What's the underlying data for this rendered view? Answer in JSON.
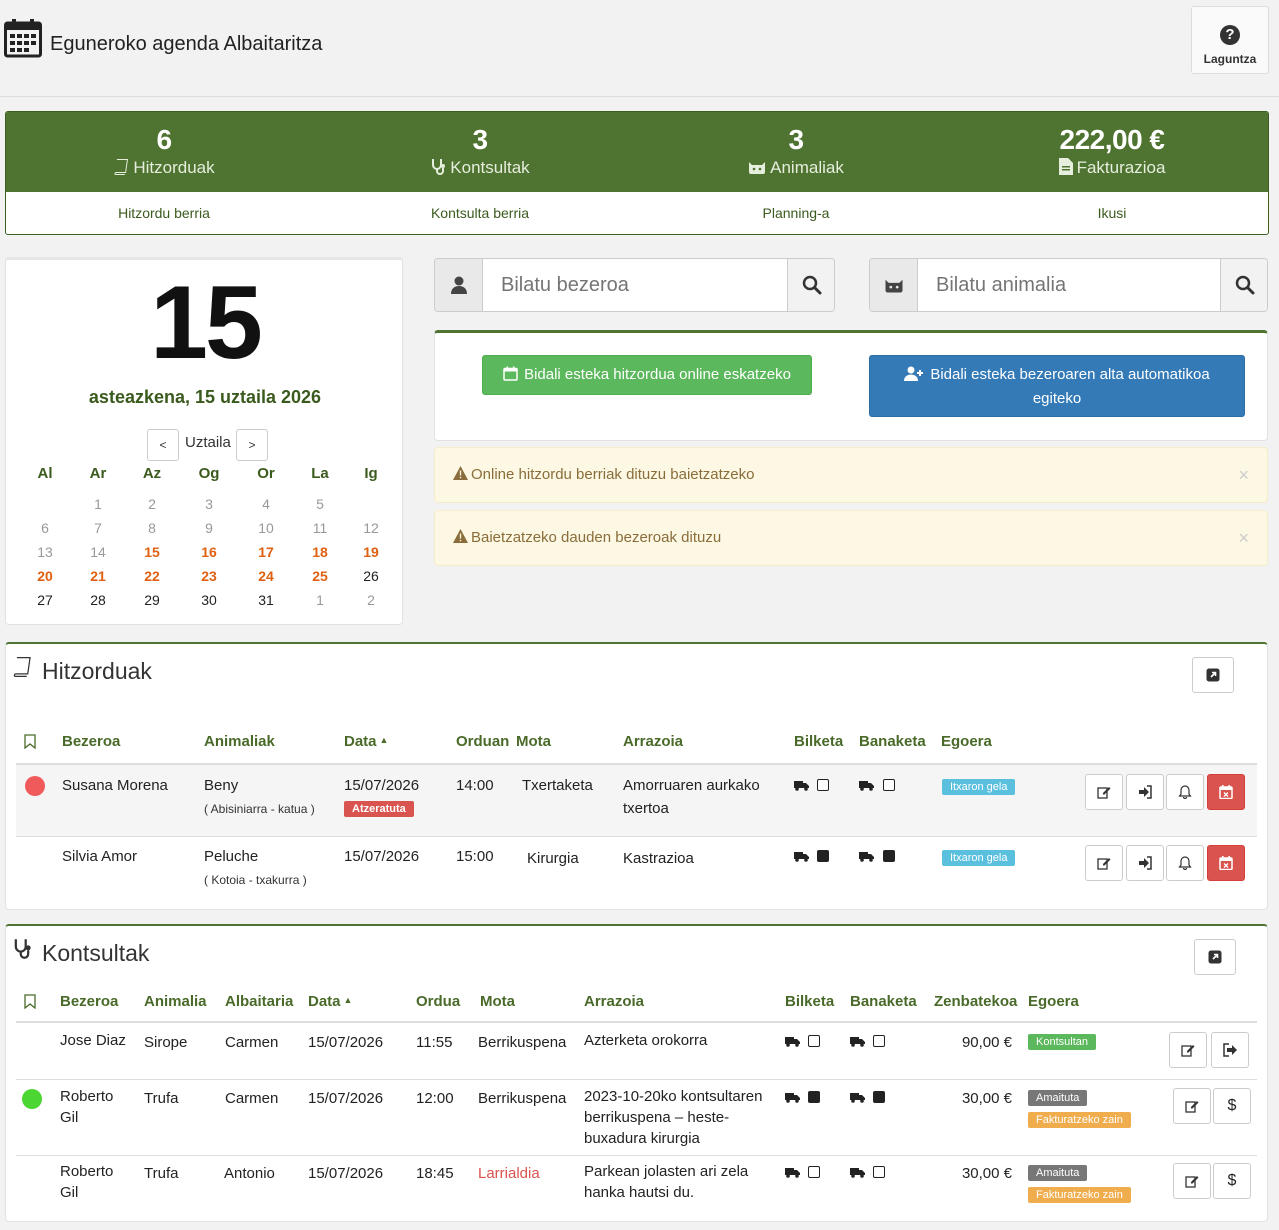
{
  "header": {
    "title": "Eguneroko agenda Albaitaritza",
    "help_label": "Laguntza",
    "calendar_icon": "calendar-icon",
    "help_icon": "question-circle-icon"
  },
  "stats": [
    {
      "number": "6",
      "label": "Hitzorduak",
      "link": "Hitzordu berria",
      "icon": "book-icon"
    },
    {
      "number": "3",
      "label": "Kontsultak",
      "link": "Kontsulta berria",
      "icon": "stethoscope-icon"
    },
    {
      "number": "3",
      "label": "Animaliak",
      "link": "Planning-a",
      "icon": "cat-icon"
    },
    {
      "number": "222,00 €",
      "label": "Fakturazioa",
      "link": "Ikusi",
      "icon": "file-icon"
    }
  ],
  "calendar": {
    "big_day": "15",
    "long_date": "asteazkena, 15 uztaila 2026",
    "month": "Uztaila",
    "prev": "<",
    "next": ">",
    "weekdays": [
      "Al",
      "Ar",
      "Az",
      "Og",
      "Or",
      "La",
      "Ig"
    ],
    "weeks": [
      [
        [
          "",
          ""
        ],
        [
          "1",
          "m"
        ],
        [
          "2",
          "m"
        ],
        [
          "3",
          "m"
        ],
        [
          "4",
          "m"
        ],
        [
          "5",
          "m"
        ],
        [
          "",
          ""
        ]
      ],
      [
        [
          "6",
          "m"
        ],
        [
          "7",
          "m"
        ],
        [
          "8",
          "m"
        ],
        [
          "9",
          "m"
        ],
        [
          "10",
          "m"
        ],
        [
          "11",
          "m"
        ],
        [
          "12",
          "m"
        ]
      ],
      [
        [
          "13",
          "m"
        ],
        [
          "14",
          "m"
        ],
        [
          "15",
          "o"
        ],
        [
          "16",
          "o"
        ],
        [
          "17",
          "o"
        ],
        [
          "18",
          "o"
        ],
        [
          "19",
          "o"
        ]
      ],
      [
        [
          "20",
          "o"
        ],
        [
          "21",
          "o"
        ],
        [
          "22",
          "o"
        ],
        [
          "23",
          "o"
        ],
        [
          "24",
          "o"
        ],
        [
          "25",
          "o"
        ],
        [
          "26",
          "n"
        ]
      ],
      [
        [
          "27",
          "n"
        ],
        [
          "28",
          "n"
        ],
        [
          "29",
          "n"
        ],
        [
          "30",
          "n"
        ],
        [
          "31",
          "n"
        ],
        [
          "1",
          "m"
        ],
        [
          "2",
          "m"
        ]
      ]
    ]
  },
  "search": {
    "client_placeholder": "Bilatu bezeroa",
    "animal_placeholder": "Bilatu animalia"
  },
  "links": {
    "online_appointment": "Bidali esteka hitzordua online eskatzeko",
    "client_signup": "Bidali esteka bezeroaren alta automatikoa egiteko"
  },
  "alerts": [
    "Online hitzordu berriak dituzu baietzatzeko",
    "Baietzatzeko dauden bezeroak dituzu"
  ],
  "close": "×",
  "appointments": {
    "title": "Hitzorduak",
    "headers": [
      "Bezeroa",
      "Animaliak",
      "Data",
      "Orduan",
      "Mota",
      "Arrazoia",
      "Bilketa",
      "Banaketa",
      "Egoera"
    ],
    "sort_indicator": "▲",
    "rows": [
      {
        "client": "Susana Morena",
        "animal": "Beny",
        "breed": "( Abisiniarra - katua )",
        "date": "15/07/2026",
        "late": "Atzeratuta",
        "time": "14:00",
        "type": "Txertaketa",
        "reason": "Amorruaren aurkako txertoa",
        "pickup": false,
        "delivery": false,
        "status": "Itxaron gela",
        "dot": "#f05a5a"
      },
      {
        "client": "Silvia  Amor",
        "animal": "Peluche",
        "breed": "( Kotoia  -  txakurra )",
        "date": "15/07/2026",
        "late": "",
        "time": "15:00",
        "type": "Kirurgia",
        "reason": "Kastrazioa",
        "pickup": true,
        "delivery": true,
        "status": "Itxaron gela",
        "dot": ""
      }
    ]
  },
  "consultations": {
    "title": "Kontsultak",
    "headers": [
      "Bezeroa",
      "Animalia",
      "Albaitaria",
      "Data",
      "Ordua",
      "Mota",
      "Arrazoia",
      "Bilketa",
      "Banaketa",
      "Zenbatekoa",
      "Egoera"
    ],
    "sort_indicator": "▲",
    "rows": [
      {
        "client": "Jose Diaz",
        "animal": "Sirope",
        "vet": "Carmen",
        "date": "15/07/2026",
        "time": "11:55",
        "type": "Berrikuspena",
        "reason": "Azterketa orokorra",
        "pickup": false,
        "delivery": false,
        "amount": "90,00 €",
        "status": [
          "Kontsultan"
        ],
        "dot": "",
        "second": "exit"
      },
      {
        "client": "Roberto Gil",
        "animal": "Trufa",
        "vet": "Carmen",
        "date": "15/07/2026",
        "time": "12:00",
        "type": "Berrikuspena",
        "reason": "2023-10-20ko kontsultaren berrikuspena – heste-buxadura kirurgia",
        "pickup": true,
        "delivery": true,
        "amount": "30,00 €",
        "status": [
          "Amaituta",
          "Fakturatzeko zain"
        ],
        "dot": "#4cd632",
        "second": "$"
      },
      {
        "client": "Roberto Gil",
        "animal": "Trufa",
        "vet": "Antonio",
        "date": "15/07/2026",
        "time": "18:45",
        "type": "Larrialdia",
        "reason": "Parkean jolasten ari zela hanka hautsi du.",
        "pickup": false,
        "delivery": false,
        "amount": "30,00 €",
        "status": [
          "Amaituta",
          "Fakturatzeko zain"
        ],
        "dot": "",
        "second": "$"
      }
    ]
  },
  "colors": {
    "brand": "#4f7330",
    "orange": "#e06010",
    "emergency": "#d9534f"
  }
}
